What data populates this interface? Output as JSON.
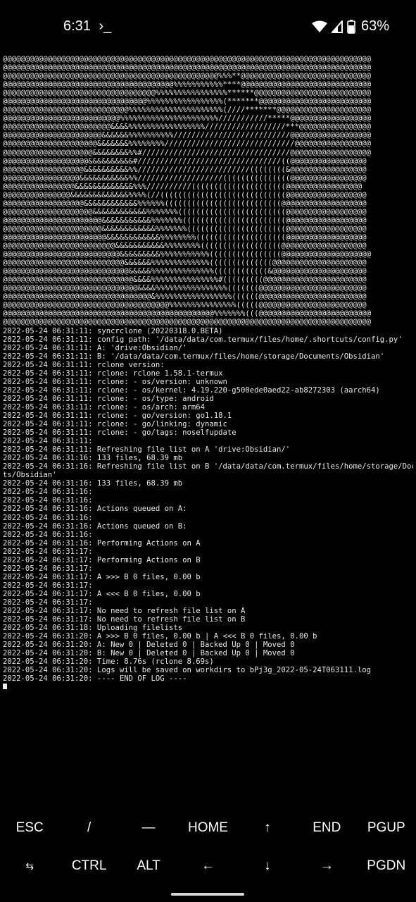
{
  "status_bar": {
    "time": "6:31",
    "terminal_indicator": "›_",
    "battery_percent": "63%",
    "icons": [
      "wifi-icon",
      "cellular-signal-icon",
      "battery-icon"
    ]
  },
  "terminal": {
    "lines": [
      "@@@@@@@@@@@@@@@@@@@@@@@@@@@@@@@@@@@@@@@@@@@@@@@@@@@@@@@@@@@@@@@@@@@@@@@@@@@@@@@@@@",
      "@@@@@@@@@@@@@@@@@@@@@@@@@@@@@@@@@@@@@@@@@@@@@@@@@@@@@@@@@@@@@@@@@@@@@@@@@@@@@@@@@@",
      "@@@@@@@@@@@@@@@@@@@@@@@@@@@@@@@@@@@@@@@@@@@@@@@@%%%**@@@@@@@@@@@@@@@@@@@@@@@@@@@@@",
      "@@@@@@@@@@@@@@@@@@@@@@@@@@@@@@@@@@@@@@%%%%%%%%%%%****@@@@@@@@@@@@@@@@@@@@@@@@@@@@@",
      "@@@@@@@@@@@@@@@@@@@@@@@@@@@@@@@@@@%%%%%%%%%%%%%%%%******@@@@@@@@@@@@@@@@@@@@@@@@@@",
      "@@@@@@@@@@@@@@@@@@@@@@@@@@@@@@@@%%%%%%%%%%%%%%%%%(*******@@@@@@@@@@@@@@@@@@@@@@@@@",
      "@@@@@@@@@@@@@@@@@@@@@@@@@@@@%%%%%%%%%%%%%%%%%%%%%(////*******@@@@@@@@@@@@@@@@@@@@@",
      "@@@@@@@@@@@@@@@@@@@@@@@@@@%%%%%%%%%%%%%%%%%%%%%%///////////*****@@@@@@@@@@@@@@@@@@",
      "@@@@@@@@@@@@@@@@@@@@@@@@&&&&%%%%%%%%%%%%%%%%%//////////////////***@@@@@@@@@@@@@@@@",
      "@@@@@@@@@@@@@@@@@@@@@@&&&&&&%%%%%%%%%%//////////////////////////@@@@@@@@@@@@@@@@@@",
      "@@@@@@@@@@@@@@@@@@@@@&&&&&&&%%%%%%%%/////////////////////////////@@@@@@@@@@@@@@@@@",
      "@@@@@@@@@@@@@@@@@@@@&&&&&&&&%%#/////////////////////////////////@@@@@@@@@@@@@@@@@@",
      "@@@@@@@@@@@@@@@@@@@&&&&&&&&&&#////////////////////////////////((@@@@@@@@@@@@@@@@@",
      "@@@@@@@@@@@@@@@@@@&&&&&&&&&&%%/////////////////////////((((((((&@@@@@@@@@@@@@@@@@",
      "@@@@@@@@@@@@@@@@@&&&&&&&&&&&%%///////////////////(((((((((((((((@@@@@@@@@@@@@@@@@",
      "@@@@@@@@@@@@@@@@&&&&&&&&&&&&&%%%//////////(((((((((((((((((((((@@@@@@@@@@@@@@@@@",
      "@@@@@@@@@@@@@@@&&&&&&&&&&&&&%%%%(//((((((((((((((((((((((((((((@@@@@@@@@@@@@@@@@@",
      "@@@@@@@@@@@@@@@@@@&&&&&&&&&&&&%%%%%%((((((((((((((((((((((((((@@@@@@@@@@@@@@@@@@@",
      "@@@@@@@@@@@@@@@@@@@@&&&&&&&&&&&&%%%%%%%((((((((((((((((((((((((@@@@@@@@@@@@@@@@@@",
      "@@@@@@@@@@@@@@@@@@@@@@&&&&&&&&&&&%%%%%%%(((((((((((((((((((((((@@@@@@@@@@@@@@@@@@",
      "@@@@@@@@@@@@@@@@@@@@@@&&&&&&&&&&&&%%%%%%%((((((((((((((((((((((@@@@@@@@@@@@@@@@@@",
      "@@@@@@@@@@@@@@@@@@@@@@@&&&&&&&&&&&&%%%%%%%%((((((((((((((((((((@@@@@@@@@@@@@@@@@@",
      "@@@@@@@@@@@@@@@@@@@@@@@@@&&&&&&&&&&&%%%%%%%%((((((((((((((((((@@@@@@@@@@@@@@@@@@@",
      "@@@@@@@@@@@@@@@@@@@@@@@@@@&&&&&&&&&%%%%%%%%%%%((((((((((((((((@@@@@@@@@@@@@@@@@@@@",
      "@@@@@@@@@@@@@@@@@@@@@@@@@@@&&&&&&%%%%%%%%%%%%%((((((((((((((@@@@@@@@@@@@@@@@@@@@@",
      "@@@@@@@@@@@@@@@@@@@@@@@@@@@@&&&&&%%%%%%%%%%%%%%((((((((((((&@@@@@@@@@@@@@@@@@@@@@",
      "@@@@@@@@@@@@@@@@@@@@@@@@@@@@@&&&&%%%%%%%%%%%%%%%#(((((((((@@@@@@@@@@@@@@@@@@@@@@@",
      "@@@@@@@@@@@@@@@@@@@@@@@@@@@@@@&&&&%%%%%%%%%%%%%%%%(((((((@@@@@@@@@@@@@@@@@@@@@@@@",
      "@@@@@@@@@@@@@@@@@@@@@@@@@@@@@@@@@&%%%%%%%%%%%%%%%%%((((((@@@@@@@@@@@@@@@@@@@@@@@@",
      "@@@@@@@@@@@@@@@@@@@@@@@@@@@@@@@@@@@@@%%%%%%%%%%%%%%%(((((@@@@@@@@@@@@@@@@@@@@@@@@",
      "@@@@@@@@@@@@@@@@@@@@@@@@@@@@@@@@@@@@@@@@@@@@@@@%%%%%%%(((@@@@@@@@@@@@@@@@@@@@@@@@@",
      "@@@@@@@@@@@@@@@@@@@@@@@@@@@@@@@@@@@@@@@@@@@@@@@@@@@@@@@@@@@@@@@@@@@@@@@@@@@@@@@@@@",
      "2022-05-24 06:31:11: syncrclone (20220318.0.BETA)",
      "2022-05-24 06:31:11: config path: '/data/data/com.termux/files/home/.shortcuts/config.py'",
      "2022-05-24 06:31:11: A: 'drive:Obsidian/'",
      "2022-05-24 06:31:11: B: '/data/data/com.termux/files/home/storage/Documents/Obsidian'",
      "2022-05-24 06:31:11: rclone version:",
      "2022-05-24 06:31:11: rclone: rclone 1.58.1-termux",
      "2022-05-24 06:31:11: rclone: - os/version: unknown",
      "2022-05-24 06:31:11: rclone: - os/kernel: 4.19.220-g500ede0aed22-ab8272303 (aarch64)",
      "2022-05-24 06:31:11: rclone: - os/type: android",
      "2022-05-24 06:31:11: rclone: - os/arch: arm64",
      "2022-05-24 06:31:11: rclone: - go/version: go1.18.1",
      "2022-05-24 06:31:11: rclone: - go/linking: dynamic",
      "2022-05-24 06:31:11: rclone: - go/tags: noselfupdate",
      "2022-05-24 06:31:11:",
      "2022-05-24 06:31:11: Refreshing file list on A 'drive:Obsidian/'",
      "2022-05-24 06:31:16: 133 files, 68.39 mb",
      "2022-05-24 06:31:16: Refreshing file list on B '/data/data/com.termux/files/home/storage/Documen",
      "ts/Obsidian'",
      "2022-05-24 06:31:16: 133 files, 68.39 mb",
      "2022-05-24 06:31:16:",
      "2022-05-24 06:31:16:",
      "2022-05-24 06:31:16: Actions queued on A:",
      "2022-05-24 06:31:16:",
      "2022-05-24 06:31:16: Actions queued on B:",
      "2022-05-24 06:31:16:",
      "2022-05-24 06:31:16: Performing Actions on A",
      "2022-05-24 06:31:17:",
      "2022-05-24 06:31:17: Performing Actions on B",
      "2022-05-24 06:31:17:",
      "2022-05-24 06:31:17: A >>> B 0 files, 0.00 b",
      "2022-05-24 06:31:17:",
      "2022-05-24 06:31:17: A <<< B 0 files, 0.00 b",
      "2022-05-24 06:31:17:",
      "2022-05-24 06:31:17: No need to refresh file list on A",
      "2022-05-24 06:31:17: No need to refresh file list on B",
      "2022-05-24 06:31:18: Uploading filelists",
      "2022-05-24 06:31:20: A >>> B 0 files, 0.00 b | A <<< B 0 files, 0.00 b",
      "2022-05-24 06:31:20: A: New 0 | Deleted 0 | Backed Up 0 | Moved 0",
      "2022-05-24 06:31:20: B: New 0 | Deleted 0 | Backed Up 0 | Moved 0",
      "2022-05-24 06:31:20: Time: 8.76s (rclone 8.69s)",
      "2022-05-24 06:31:20: Logs will be saved on workdirs to bPj3g_2022-05-24T063111.log",
      "2022-05-24 06:31:20: ---- END OF LOG ----"
    ]
  },
  "extra_keys": {
    "row1": [
      {
        "name": "esc-key",
        "label": "ESC"
      },
      {
        "name": "slash-key",
        "label": "/"
      },
      {
        "name": "dash-key",
        "label": "—"
      },
      {
        "name": "home-key",
        "label": "HOME"
      },
      {
        "name": "up-arrow-key",
        "label": "↑"
      },
      {
        "name": "end-key",
        "label": "END"
      },
      {
        "name": "pgup-key",
        "label": "PGUP"
      }
    ],
    "row2": [
      {
        "name": "tab-key",
        "label": "⇆",
        "icon": "tab-icon"
      },
      {
        "name": "ctrl-key",
        "label": "CTRL"
      },
      {
        "name": "alt-key",
        "label": "ALT"
      },
      {
        "name": "left-arrow-key",
        "label": "←"
      },
      {
        "name": "down-arrow-key",
        "label": "↓"
      },
      {
        "name": "right-arrow-key",
        "label": "→"
      },
      {
        "name": "pgdn-key",
        "label": "PGDN"
      }
    ]
  }
}
